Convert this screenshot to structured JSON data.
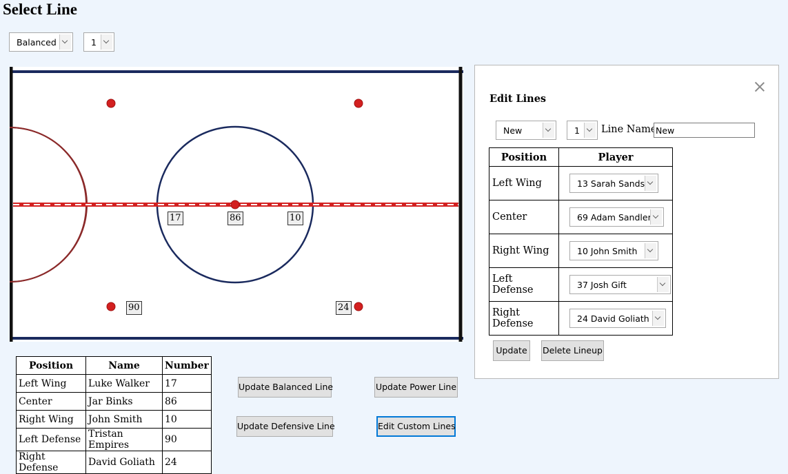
{
  "page": {
    "title": "Select Line"
  },
  "top_selects": {
    "line_type": "Balanced",
    "line_number": "1"
  },
  "rink": {
    "markers": [
      {
        "position": "left-wing",
        "number": "17"
      },
      {
        "position": "center",
        "number": "86"
      },
      {
        "position": "right-wing",
        "number": "10"
      },
      {
        "position": "left-defense",
        "number": "90"
      },
      {
        "position": "right-defense",
        "number": "24"
      }
    ]
  },
  "lineup_table": {
    "headers": [
      "Position",
      "Name",
      "Number"
    ],
    "rows": [
      [
        "Left Wing",
        "Luke Walker",
        "17"
      ],
      [
        "Center",
        "Jar Binks",
        "86"
      ],
      [
        "Right Wing",
        "John Smith",
        "10"
      ],
      [
        "Left Defense",
        "Tristan Empires",
        "90"
      ],
      [
        "Right Defense",
        "David Goliath",
        "24"
      ]
    ]
  },
  "buttons": {
    "update_balanced": "Update Balanced Line",
    "update_power": "Update Power Line",
    "update_defensive": "Update Defensive Line",
    "edit_custom": "Edit Custom Lines"
  },
  "edit_panel": {
    "title": "Edit Lines",
    "lineup_select": "New",
    "number_select": "1",
    "line_name_label": "Line Name",
    "line_name_value": "New",
    "headers": [
      "Position",
      "Player"
    ],
    "rows": [
      {
        "position": "Left Wing",
        "player": "13 Sarah Sands"
      },
      {
        "position": "Center",
        "player": "69 Adam Sandler"
      },
      {
        "position": "Right Wing",
        "player": "10 John Smith"
      },
      {
        "position": "Left Defense",
        "player": "37 Josh Gift"
      },
      {
        "position": "Right Defense",
        "player": "24 David Goliath"
      }
    ],
    "update_label": "Update",
    "delete_label": "Delete Lineup"
  },
  "colors": {
    "page_bg": "#eef5fd",
    "rink_blue": "#1a2a5e",
    "rink_red": "#d32020",
    "focus": "#0078d7"
  }
}
